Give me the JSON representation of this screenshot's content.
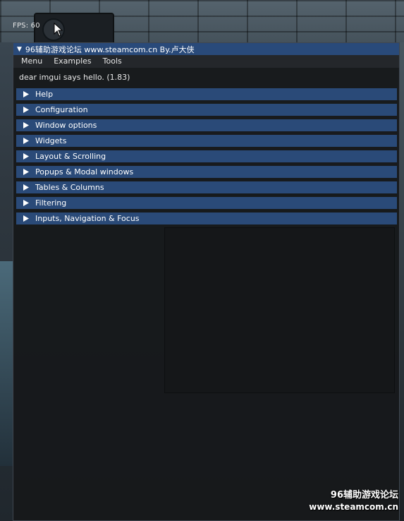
{
  "overlay": {
    "fps_text": "FPS: 60"
  },
  "window": {
    "title": "96辅助游戏论坛 www.steamcom.cn By.卢大侠",
    "menu": [
      "Menu",
      "Examples",
      "Tools"
    ],
    "hello_text": "dear imgui says hello. (1.83)",
    "sections": [
      "Help",
      "Configuration",
      "Window options",
      "Widgets",
      "Layout & Scrolling",
      "Popups & Modal windows",
      "Tables & Columns",
      "Filtering",
      "Inputs, Navigation & Focus"
    ]
  },
  "watermark": {
    "line1": "96辅助游戏论坛",
    "line2": "www.steamcom.cn"
  },
  "colors": {
    "title_bar": "#294a7a",
    "header": "#2a4a78",
    "window_bg": "#16181b"
  },
  "icons": {
    "collapse": "triangle-down-icon",
    "section": "triangle-right-icon",
    "cursor": "mouse-cursor-icon"
  }
}
